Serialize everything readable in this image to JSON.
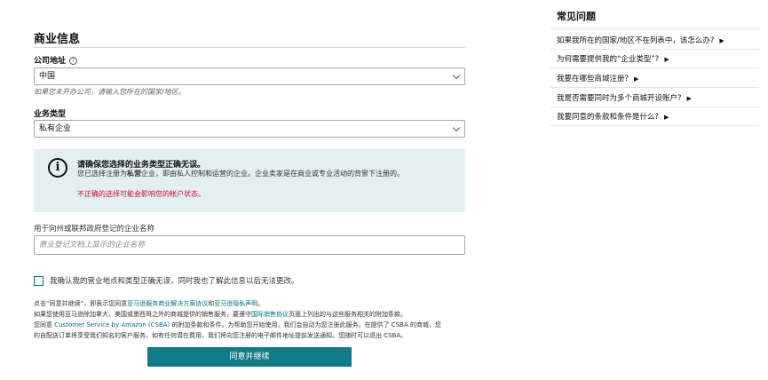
{
  "form": {
    "heading": "商业信息",
    "address_label": "公司地址",
    "address_help_icon": "?",
    "address_value": "中国",
    "address_hint": "如果您未开办公司，请输入您所在的国家/地区。",
    "business_type_label": "业务类型",
    "business_type_value": "私有企业",
    "info": {
      "icon": "i",
      "title": "请确保您选择的业务类型正确无误。",
      "body_prefix": "您已选择注册为",
      "body_bold": "私营",
      "body_suffix": "企业，即由私人控制和运营的企业。企业卖家是在商业或专业活动的背景下注册的。",
      "warning": "不正确的选择可能会影响您的帐户状态。"
    },
    "name_label": "用于向州或联邦政府登记的企业名称",
    "name_placeholder": "商业登记文档上显示的企业名称",
    "confirm_label": "我确认我的营业地点和类型正确无误，同时我也了解此信息以后无法更改。",
    "legal": {
      "line1_a": "点击“同意并继续”，即表示您同意",
      "line1_link1": "亚马逊服务商业解决方案协议",
      "line1_b": "和",
      "line1_link2": "亚马逊隐私声明",
      "line1_c": "。",
      "line2_a": "如果您使用亚马逊除加拿大、美国或墨西哥之外的商城提供的销售服务，要遵守",
      "line2_link": "国际销售协议",
      "line2_b": "页面上列出的与这些服务相关的附加条款。",
      "line3_a": "您同意 ",
      "line3_link": "Customer Service by Amazon (CSBA)",
      "line3_b": " 的附加条款和条件。为帮助您开始使用，我们会自动为您注册此服务。在提供了 CSBA 的商城，您",
      "line4": "的自配送订单将享受我们知名的客户服务。如有任何潜在费用，我们将向您注册的电子邮件地址提前发送通知。您随时可以退出 CSBA。"
    },
    "submit_label": "同意并继续"
  },
  "faq": {
    "title": "常见问题",
    "items": [
      "如果我所在的国家/地区不在列表中，该怎么办?",
      "为何需要提供我的“企业类型”?",
      "我要在哪些商城注册?",
      "我是否需要同时为多个商城开设账户?",
      "我要同意的条款和条件是什么?"
    ],
    "expand_glyph": "▶"
  },
  "colors": {
    "accent": "#007185",
    "button": "#137a87",
    "info_bg": "#e3eff0",
    "warning": "#cc0c39"
  }
}
